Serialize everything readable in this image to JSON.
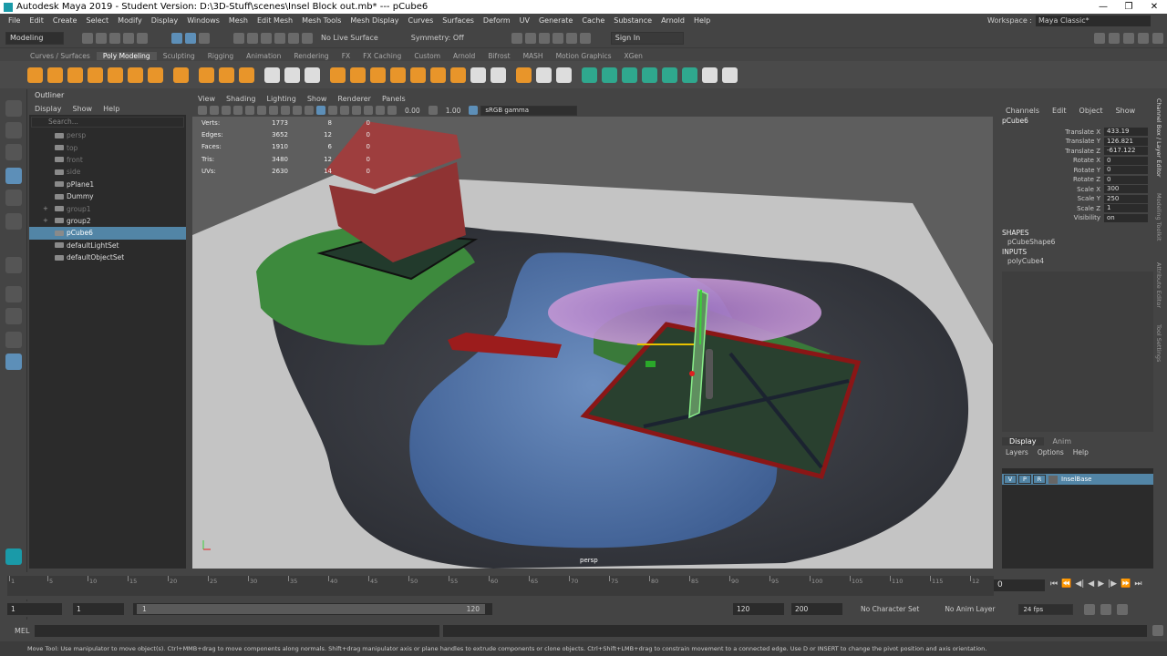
{
  "window": {
    "title": "Autodesk Maya 2019 - Student Version: D:\\3D-Stuff\\scenes\\Insel Block out.mb*   ---   pCube6"
  },
  "menus": [
    "File",
    "Edit",
    "Create",
    "Select",
    "Modify",
    "Display",
    "Windows",
    "Mesh",
    "Edit Mesh",
    "Mesh Tools",
    "Mesh Display",
    "Curves",
    "Surfaces",
    "Deform",
    "UV",
    "Generate",
    "Cache",
    "Substance",
    "Arnold",
    "Help"
  ],
  "workspace": {
    "label": "Workspace :",
    "value": "Maya Classic*"
  },
  "status_line": {
    "mode": "Modeling",
    "live_surface": "No Live Surface",
    "symmetry": "Symmetry: Off",
    "sign_in": "Sign In"
  },
  "shelf_tabs": [
    "Curves / Surfaces",
    "Poly Modeling",
    "Sculpting",
    "Rigging",
    "Animation",
    "Rendering",
    "FX",
    "FX Caching",
    "Custom",
    "Arnold",
    "Bifrost",
    "MASH",
    "Motion Graphics",
    "XGen"
  ],
  "shelf_active": "Poly Modeling",
  "outliner": {
    "title": "Outliner",
    "menu": [
      "Display",
      "Show",
      "Help"
    ],
    "search_placeholder": "Search...",
    "items": [
      {
        "label": "persp",
        "dim": true,
        "exp": ""
      },
      {
        "label": "top",
        "dim": true,
        "exp": ""
      },
      {
        "label": "front",
        "dim": true,
        "exp": ""
      },
      {
        "label": "side",
        "dim": true,
        "exp": ""
      },
      {
        "label": "pPlane1",
        "dim": false,
        "exp": ""
      },
      {
        "label": "Dummy",
        "dim": false,
        "exp": ""
      },
      {
        "label": "group1",
        "dim": true,
        "exp": "+"
      },
      {
        "label": "group2",
        "dim": false,
        "exp": "+"
      },
      {
        "label": "pCube6",
        "dim": false,
        "exp": "",
        "selected": true
      },
      {
        "label": "defaultLightSet",
        "dim": false,
        "exp": ""
      },
      {
        "label": "defaultObjectSet",
        "dim": false,
        "exp": ""
      }
    ]
  },
  "viewport": {
    "menu": [
      "View",
      "Shading",
      "Lighting",
      "Show",
      "Renderer",
      "Panels"
    ],
    "exposure": "0.00",
    "gamma": "1.00",
    "color_space": "sRGB gamma",
    "camera": "persp",
    "hud": [
      {
        "k": "Verts:",
        "a": "1773",
        "b": "8",
        "c": "0"
      },
      {
        "k": "Edges:",
        "a": "3652",
        "b": "12",
        "c": "0"
      },
      {
        "k": "Faces:",
        "a": "1910",
        "b": "6",
        "c": "0"
      },
      {
        "k": "Tris:",
        "a": "3480",
        "b": "12",
        "c": "0"
      },
      {
        "k": "UVs:",
        "a": "2630",
        "b": "14",
        "c": "0"
      }
    ]
  },
  "channel_box": {
    "menu": [
      "Channels",
      "Edit",
      "Object",
      "Show"
    ],
    "object": "pCube6",
    "attrs": [
      {
        "n": "Translate X",
        "v": "433.19"
      },
      {
        "n": "Translate Y",
        "v": "126.821"
      },
      {
        "n": "Translate Z",
        "v": "-617.122"
      },
      {
        "n": "Rotate X",
        "v": "0"
      },
      {
        "n": "Rotate Y",
        "v": "0"
      },
      {
        "n": "Rotate Z",
        "v": "0"
      },
      {
        "n": "Scale X",
        "v": "300"
      },
      {
        "n": "Scale Y",
        "v": "250"
      },
      {
        "n": "Scale Z",
        "v": "1"
      },
      {
        "n": "Visibility",
        "v": "on"
      }
    ],
    "shapes_label": "SHAPES",
    "shape": "pCubeShape6",
    "inputs_label": "INPUTS",
    "input": "polyCube4"
  },
  "side_tabs": [
    "Channel Box / Layer Editor",
    "Modeling Toolkit",
    "Attribute Editor",
    "Tool Settings"
  ],
  "layers": {
    "tabs": [
      "Display",
      "Anim"
    ],
    "menu": [
      "Layers",
      "Options",
      "Help"
    ],
    "layer": {
      "v": "V",
      "p": "P",
      "r": "R",
      "name": "InselBase"
    }
  },
  "timeline": {
    "ticks": [
      "1",
      "5",
      "10",
      "15",
      "20",
      "25",
      "30",
      "35",
      "40",
      "45",
      "50",
      "55",
      "60",
      "65",
      "70",
      "75",
      "80",
      "85",
      "90",
      "95",
      "100",
      "105",
      "110",
      "115",
      "12"
    ],
    "current": "0"
  },
  "range": {
    "start": "1",
    "start2": "1",
    "slider_start": "1",
    "slider_end": "120",
    "end": "120",
    "end2": "200",
    "character": "No Character Set",
    "anim_layer": "No Anim Layer",
    "fps": "24 fps"
  },
  "mel": "MEL",
  "help_line": "Move Tool: Use manipulator to move object(s). Ctrl+MMB+drag to move components along normals. Shift+drag manipulator axis or plane handles to extrude components or clone objects. Ctrl+Shift+LMB+drag to constrain movement to a connected edge. Use D or INSERT to change the pivot position and axis orientation."
}
